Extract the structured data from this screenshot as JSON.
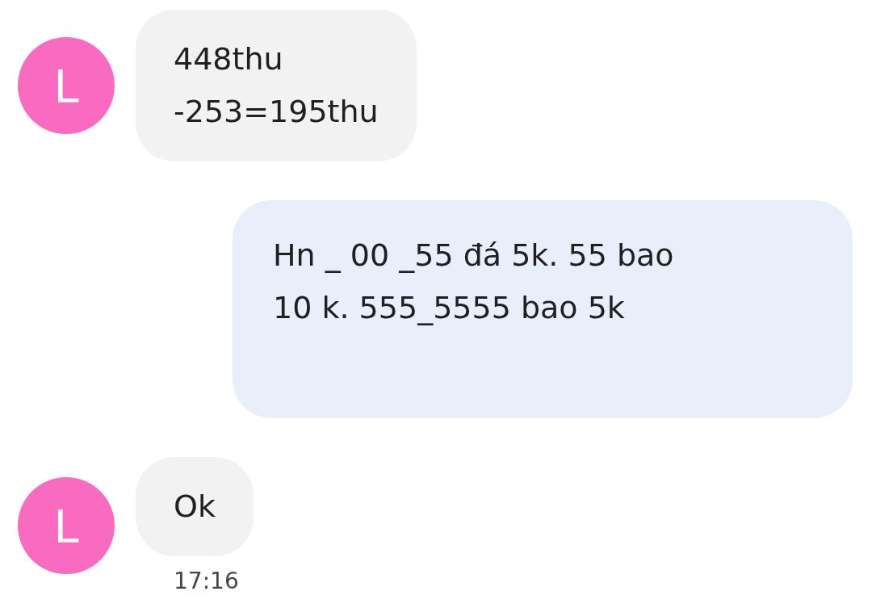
{
  "messages": [
    {
      "kind": "received",
      "avatar": "L",
      "text": "448thu\n-253=195thu"
    },
    {
      "kind": "sent",
      "text": "Hn _ 00 _55 đá 5k. 55 bao\n10 k. 555_5555 bao 5k"
    },
    {
      "kind": "received",
      "avatar": "L",
      "text": "Ok",
      "time": "17:16"
    }
  ]
}
